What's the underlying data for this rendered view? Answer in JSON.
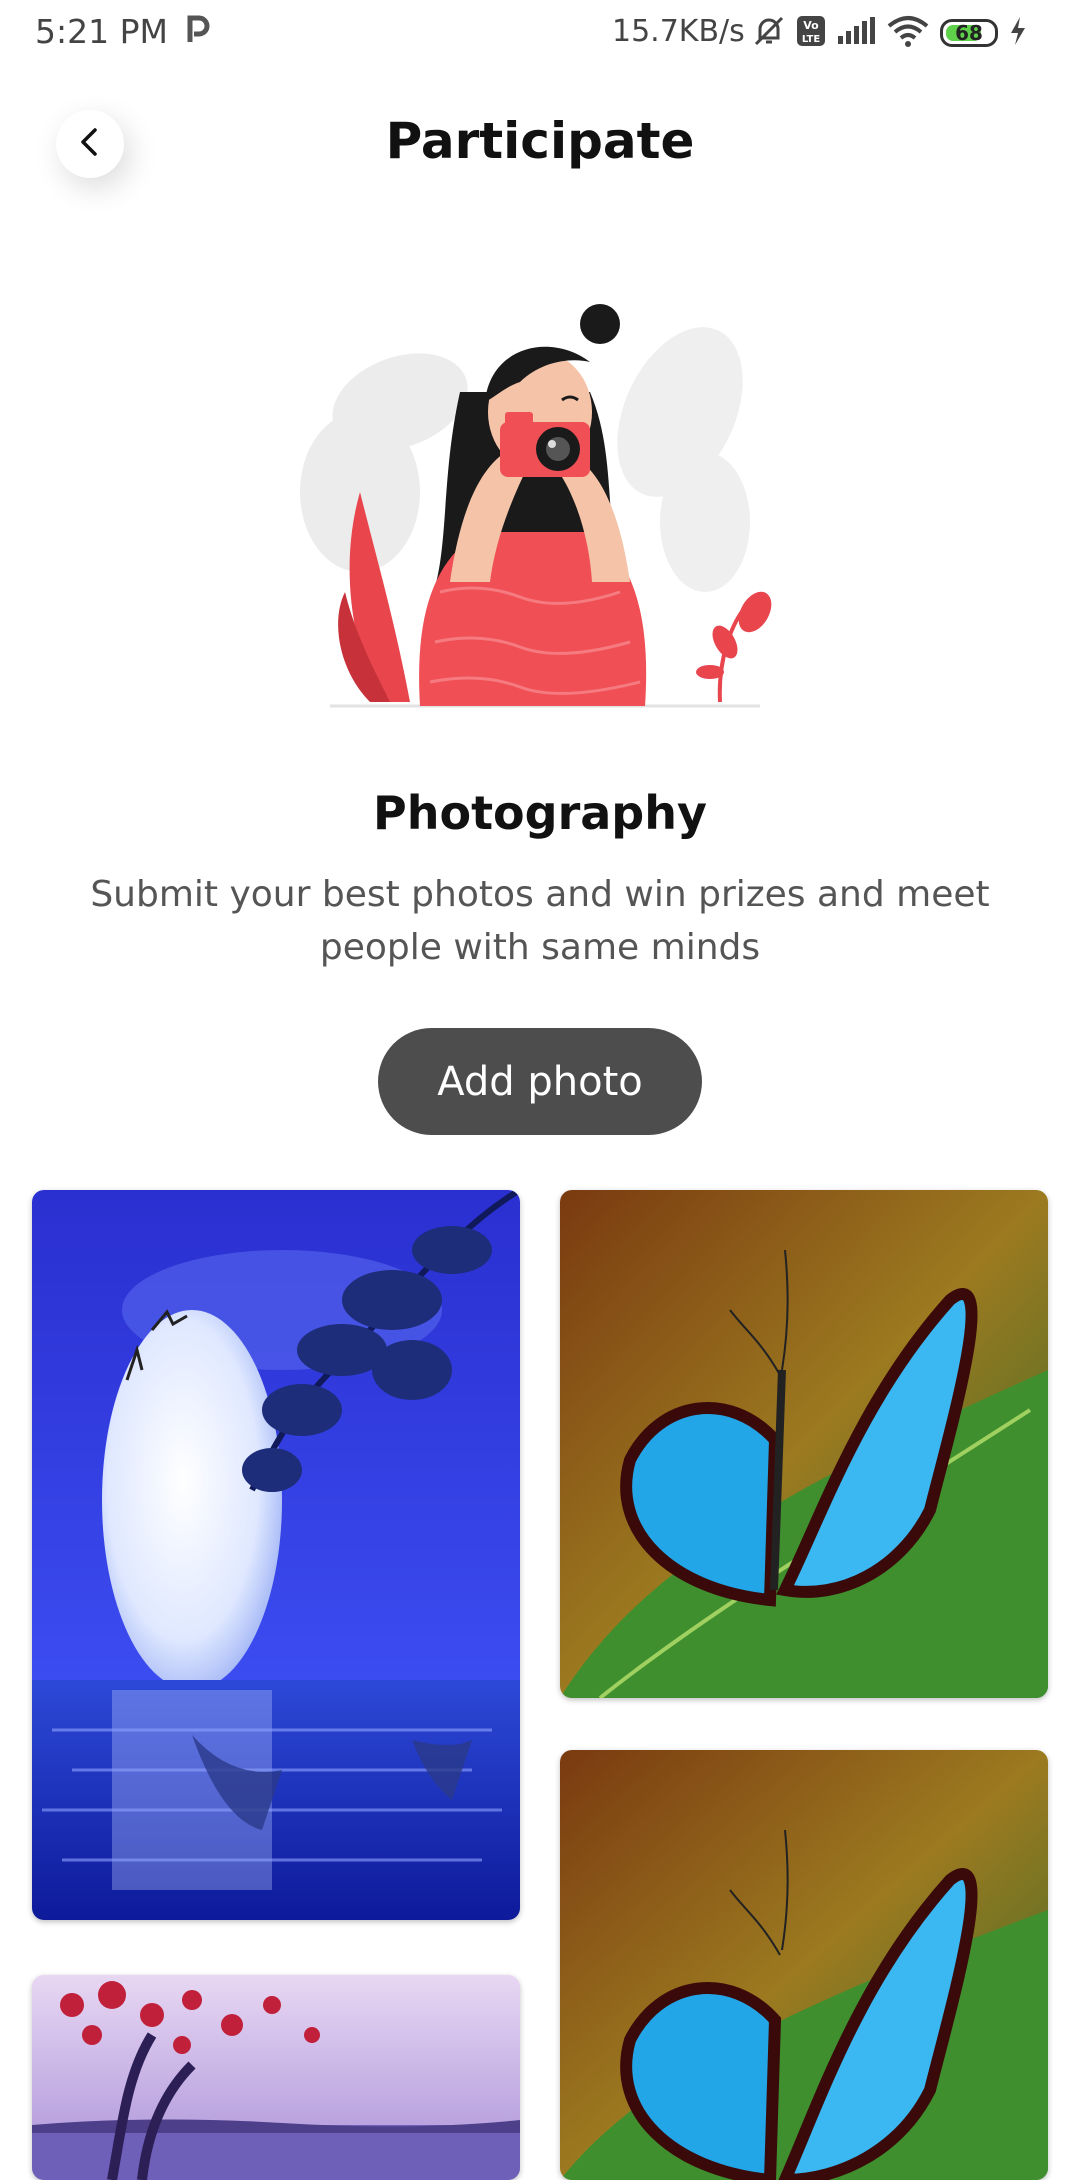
{
  "status_bar": {
    "time": "5:21 PM",
    "network_speed": "15.7KB/s",
    "battery_level": "68",
    "icons": [
      "p-app-icon",
      "mute-icon",
      "volte-icon",
      "signal-icon",
      "wifi-icon",
      "battery-icon",
      "charging-icon"
    ]
  },
  "header": {
    "title": "Participate",
    "back_icon": "chevron-left-icon"
  },
  "hero": {
    "illustration": "photographer-illustration"
  },
  "section": {
    "title": "Photography",
    "description": "Submit your best photos and win prizes and meet people with same minds"
  },
  "actions": {
    "add_photo_label": "Add photo"
  },
  "gallery": {
    "photos": [
      {
        "subject": "moon-over-water"
      },
      {
        "subject": "blue-butterfly-on-leaf"
      },
      {
        "subject": "blue-butterfly-on-leaf"
      },
      {
        "subject": "tree-by-lake"
      }
    ]
  },
  "colors": {
    "button_bg": "#4d4d4d",
    "accent_red": "#ef4f55",
    "text_primary": "#111111",
    "text_secondary": "#555555"
  }
}
